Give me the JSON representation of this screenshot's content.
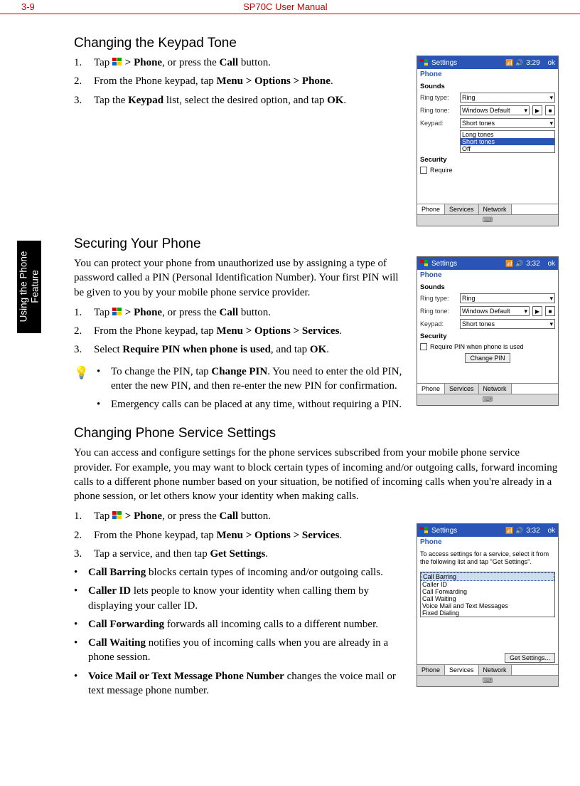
{
  "header": {
    "page": "3-9",
    "title": "SP70C User Manual"
  },
  "sidetab": "Using the Phone\nFeature",
  "s1": {
    "heading": "Changing the Keypad Tone",
    "steps": [
      {
        "n": "1.",
        "pre": "Tap ",
        "bold1": "> Phone",
        "mid": ", or press the ",
        "bold2": "Call",
        "post": " button."
      },
      {
        "n": "2.",
        "pre": "From the Phone keypad, tap ",
        "bold1": "Menu > Options > Phone",
        "post": "."
      },
      {
        "n": "3.",
        "pre": "Tap the ",
        "bold1": "Keypad",
        "mid": " list, select the desired option, and tap ",
        "bold2": "OK",
        "post": "."
      }
    ],
    "device": {
      "title": "Settings",
      "time": "3:29",
      "ok": "ok",
      "sub": "Phone",
      "sounds": "Sounds",
      "ringtype": {
        "lbl": "Ring type:",
        "val": "Ring"
      },
      "ringtone": {
        "lbl": "Ring tone:",
        "val": "Windows Default"
      },
      "keypad": {
        "lbl": "Keypad:",
        "val": "Short tones"
      },
      "dropdown": [
        "Long tones",
        "Short tones",
        "Off"
      ],
      "security": "Security",
      "require": "Require",
      "tabs": [
        "Phone",
        "Services",
        "Network"
      ]
    }
  },
  "s2": {
    "heading": "Securing Your Phone",
    "intro": "You can protect your phone from unauthorized use by assigning a type of password called a PIN (Personal Identification Number). Your first PIN will be given to you by your mobile phone service provider.",
    "steps": [
      {
        "n": "1.",
        "pre": "Tap ",
        "bold1": "> Phone",
        "mid": ", or press the ",
        "bold2": "Call",
        "post": " button."
      },
      {
        "n": "2.",
        "pre": "From the Phone keypad, tap ",
        "bold1": "Menu > Options > Services",
        "post": "."
      },
      {
        "n": "3.",
        "pre": "Select ",
        "bold1": "Require PIN when phone is used",
        "mid": ", and tap ",
        "bold2": "OK",
        "post": "."
      }
    ],
    "tips": [
      {
        "pre": "To change the PIN, tap ",
        "bold": "Change PIN",
        "post": ". You need to enter the old PIN, enter the new PIN, and then re-enter the new PIN for confirmation."
      },
      {
        "pre": "Emergency calls can be placed at any time, without requiring a PIN."
      }
    ],
    "device": {
      "title": "Settings",
      "time": "3:32",
      "ok": "ok",
      "sub": "Phone",
      "sounds": "Sounds",
      "ringtype": {
        "lbl": "Ring type:",
        "val": "Ring"
      },
      "ringtone": {
        "lbl": "Ring tone:",
        "val": "Windows Default"
      },
      "keypad": {
        "lbl": "Keypad:",
        "val": "Short tones"
      },
      "security": "Security",
      "chk": "Require PIN when phone is used",
      "btn": "Change PIN",
      "tabs": [
        "Phone",
        "Services",
        "Network"
      ]
    }
  },
  "s3": {
    "heading": "Changing Phone Service Settings",
    "intro": "You can access and configure settings for the phone services subscribed from your mobile phone service provider. For example, you may want to block certain types of incoming and/or outgoing calls, forward incoming calls to a different phone number based on your situation, be notified of incoming calls when you're already in a phone session, or let others know your identity when making calls.",
    "steps": [
      {
        "n": "1.",
        "pre": "Tap ",
        "bold1": "> Phone",
        "mid": ", or press the ",
        "bold2": "Call",
        "post": " button."
      },
      {
        "n": "2.",
        "pre": "From the Phone keypad, tap ",
        "bold1": "Menu > Options > Services",
        "post": "."
      },
      {
        "n": "3.",
        "pre": "Tap a service, and then tap ",
        "bold1": "Get Settings",
        "post": "."
      }
    ],
    "bullets": [
      {
        "b": "Call Barring",
        "t": "  blocks certain types of incoming and/or outgoing calls."
      },
      {
        "b": "Caller ID",
        "t": "  lets people to know your identity when calling them by displaying your caller ID."
      },
      {
        "b": "Call Forwarding",
        "t": "  forwards all incoming calls to a different number."
      },
      {
        "b": "Call Waiting",
        "t": "  notifies you of incoming calls when you are already in a phone session."
      },
      {
        "b": "Voice Mail or Text Message Phone Number",
        "t": "  changes the voice mail or text message phone number."
      }
    ],
    "device": {
      "title": "Settings",
      "time": "3:32",
      "ok": "ok",
      "sub": "Phone",
      "para": "To access settings for a service, select it from the following list and tap \"Get Settings\".",
      "items": [
        "Call Barring",
        "Caller ID",
        "Call Forwarding",
        "Call Waiting",
        "Voice Mail and Text Messages",
        "Fixed Dialing"
      ],
      "btn": "Get Settings...",
      "tabs": [
        "Phone",
        "Services",
        "Network"
      ]
    }
  }
}
